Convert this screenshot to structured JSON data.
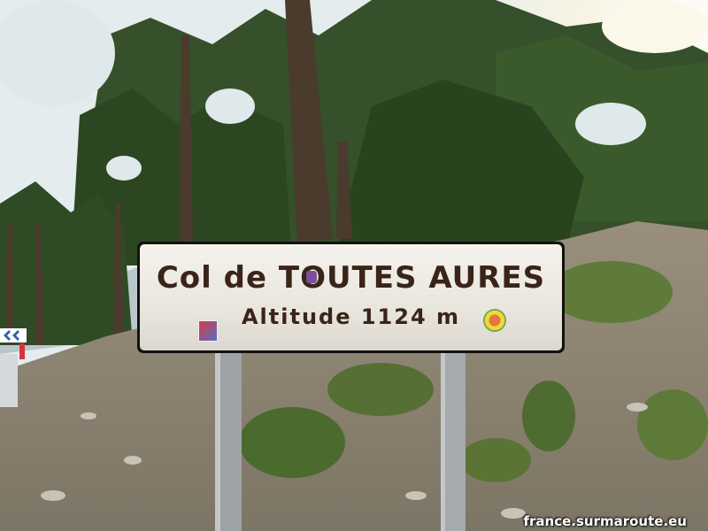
{
  "sign": {
    "line1": "Col de TOUTES AURES",
    "line2": "Altitude 1124 m"
  },
  "watermark": "france.surmaroute.eu",
  "colors": {
    "sign_background": "#ece9e2",
    "sign_border": "#111111",
    "sign_text": "#3a2418",
    "sky": "#e8f0f2",
    "foliage": "#2f4a22",
    "hillside": "#8a7f6c"
  }
}
